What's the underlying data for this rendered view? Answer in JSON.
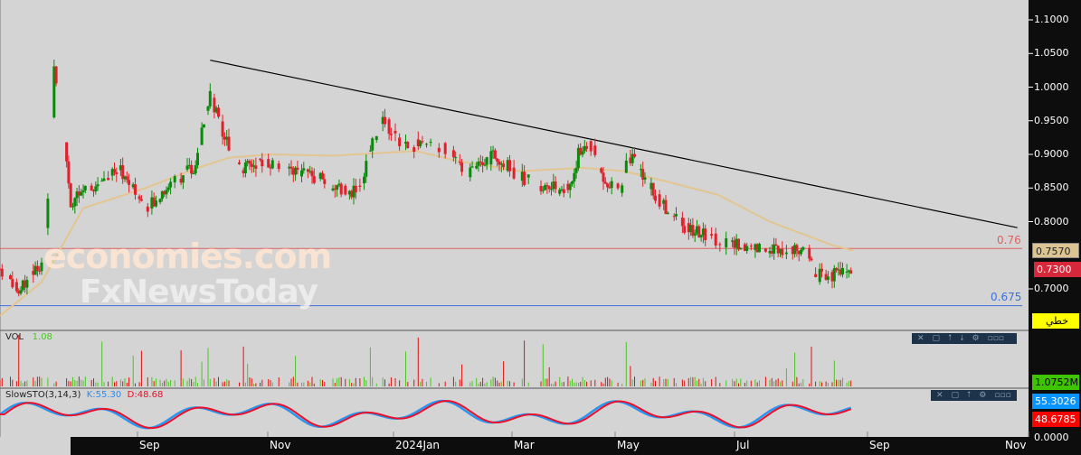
{
  "chart_data": {
    "type": "candlestick",
    "price_axis": {
      "ticks": [
        "1.1000",
        "1.0500",
        "1.0000",
        "0.9500",
        "0.9000",
        "0.8500",
        "0.8000",
        "0.7000"
      ],
      "range": [
        0.66,
        1.12
      ]
    },
    "time_axis": {
      "ticks": [
        "Sep",
        "Nov",
        "2024Jan",
        "Mar",
        "May",
        "Jul",
        "Sep",
        "Nov"
      ]
    },
    "price_path": [
      [
        0,
        0.73
      ],
      [
        9,
        0.7
      ],
      [
        20,
        0.74
      ],
      [
        23,
        0.83
      ],
      [
        26,
        1.03
      ],
      [
        30,
        0.95
      ],
      [
        34,
        0.83
      ],
      [
        43,
        0.85
      ],
      [
        57,
        0.88
      ],
      [
        70,
        0.82
      ],
      [
        83,
        0.86
      ],
      [
        93,
        0.88
      ],
      [
        101,
        0.99
      ],
      [
        107,
        0.93
      ],
      [
        117,
        0.88
      ],
      [
        126,
        0.89
      ],
      [
        139,
        0.88
      ],
      [
        157,
        0.86
      ],
      [
        167,
        0.84
      ],
      [
        174,
        0.86
      ],
      [
        180,
        0.93
      ],
      [
        185,
        0.95
      ],
      [
        191,
        0.92
      ],
      [
        204,
        0.91
      ],
      [
        217,
        0.91
      ],
      [
        222,
        0.87
      ],
      [
        230,
        0.88
      ],
      [
        238,
        0.9
      ],
      [
        248,
        0.87
      ],
      [
        261,
        0.85
      ],
      [
        274,
        0.85
      ],
      [
        278,
        0.9
      ],
      [
        283,
        0.92
      ],
      [
        289,
        0.87
      ],
      [
        298,
        0.84
      ],
      [
        302,
        0.9
      ],
      [
        309,
        0.87
      ],
      [
        317,
        0.83
      ],
      [
        330,
        0.79
      ],
      [
        348,
        0.77
      ],
      [
        361,
        0.76
      ],
      [
        378,
        0.76
      ],
      [
        389,
        0.75
      ],
      [
        391,
        0.72
      ],
      [
        400,
        0.72
      ],
      [
        409,
        0.73
      ]
    ],
    "ma_path": [
      [
        0,
        0.66
      ],
      [
        20,
        0.71
      ],
      [
        40,
        0.82
      ],
      [
        70,
        0.85
      ],
      [
        95,
        0.88
      ],
      [
        110,
        0.895
      ],
      [
        130,
        0.9
      ],
      [
        160,
        0.898
      ],
      [
        200,
        0.905
      ],
      [
        220,
        0.89
      ],
      [
        250,
        0.875
      ],
      [
        280,
        0.88
      ],
      [
        300,
        0.875
      ],
      [
        320,
        0.86
      ],
      [
        345,
        0.84
      ],
      [
        370,
        0.8
      ],
      [
        400,
        0.765
      ],
      [
        410,
        0.757
      ]
    ],
    "trendline": [
      [
        101,
        1.04
      ],
      [
        489,
        0.791
      ]
    ],
    "levels": [
      {
        "label": "0.76",
        "value": 0.76,
        "color": "#e06060"
      },
      {
        "label": "0.675",
        "value": 0.675,
        "color": "#3b6fd8"
      }
    ],
    "last_price": "0.7300",
    "ma_value": "0.7570",
    "line_type_label": "خطي",
    "volume": {
      "label": "VOL",
      "value": "1.08",
      "last": "1.0752M"
    },
    "stochastic": {
      "label": "SlowSTO(3,14,3)",
      "k": "K:55.30",
      "d": "D:48.68",
      "k_last": "55.3026",
      "d_last": "48.6785",
      "zero": "0.0000"
    }
  },
  "watermark": {
    "line1": "economies.com",
    "line2": "FxNewsToday"
  },
  "panel_toolbar": {
    "close": "✕",
    "max": "▢",
    "up": "⭡",
    "down": "⭣",
    "settings": "⚙",
    "more": "▫▫▫"
  }
}
